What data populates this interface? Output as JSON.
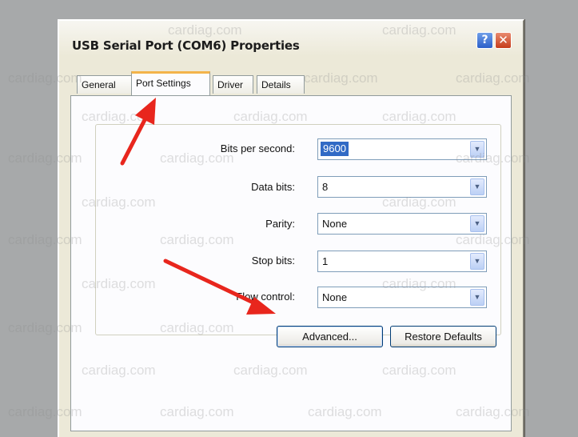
{
  "window": {
    "title": "USB Serial Port (COM6) Properties",
    "help_glyph": "?",
    "close_glyph": "✕"
  },
  "tabs": [
    {
      "label": "General"
    },
    {
      "label": "Port Settings",
      "active": true
    },
    {
      "label": "Driver"
    },
    {
      "label": "Details"
    }
  ],
  "settings": {
    "bits_per_second": {
      "label": "Bits per second:",
      "value": "9600"
    },
    "data_bits": {
      "label": "Data bits:",
      "value": "8"
    },
    "parity": {
      "label": "Parity:",
      "value": "None"
    },
    "stop_bits": {
      "label": "Stop bits:",
      "value": "1"
    },
    "flow_control": {
      "label": "Flow control:",
      "value": "None"
    }
  },
  "buttons": {
    "advanced": "Advanced...",
    "restore_defaults": "Restore Defaults"
  },
  "watermark_text": "cardiag.com",
  "colors": {
    "accent_arrow": "#e8261d",
    "selection": "#316ac5",
    "tab_highlight": "#f3b44b"
  }
}
